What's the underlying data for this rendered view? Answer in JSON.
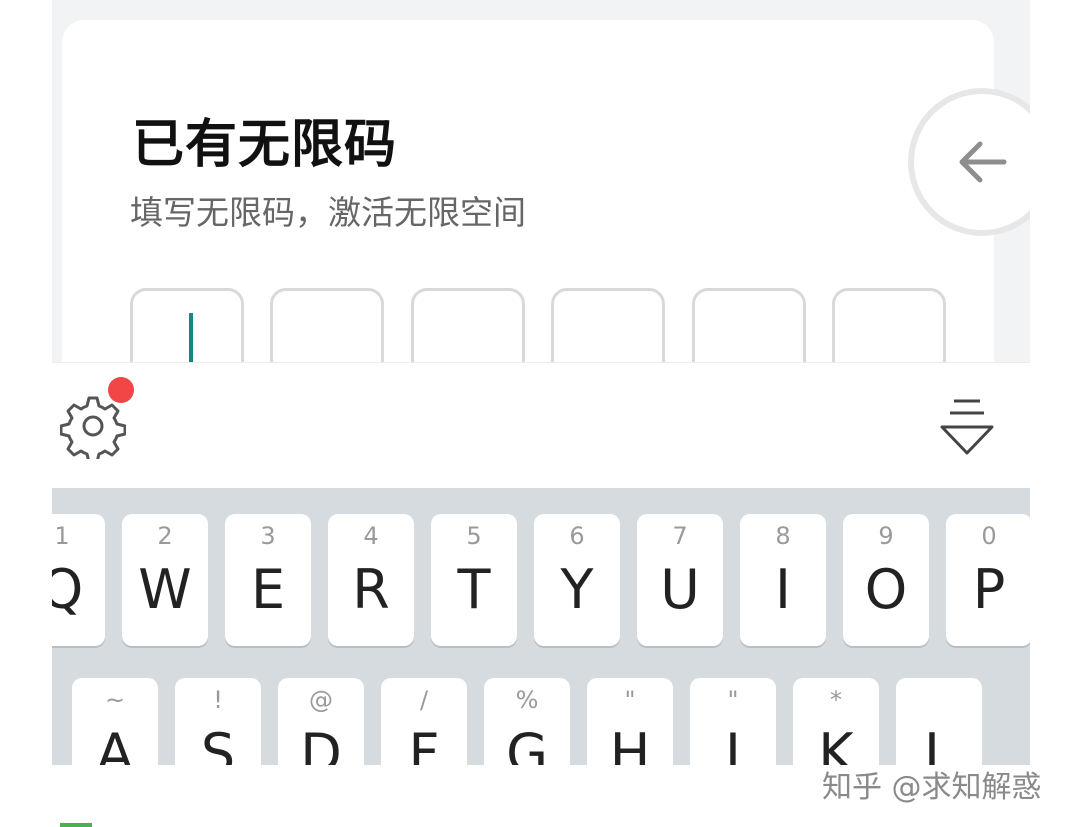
{
  "header": {
    "title": "已有无限码",
    "subtitle": "填写无限码，激活无限空间"
  },
  "code_input": {
    "box_count": 6,
    "values": [
      "",
      "",
      "",
      "",
      "",
      ""
    ]
  },
  "icons": {
    "back": "arrow-left-icon",
    "settings": "gear-icon",
    "hide_keyboard": "keyboard-hide-icon"
  },
  "keyboard": {
    "row1": [
      {
        "main": "Q",
        "alt": "1"
      },
      {
        "main": "W",
        "alt": "2"
      },
      {
        "main": "E",
        "alt": "3"
      },
      {
        "main": "R",
        "alt": "4"
      },
      {
        "main": "T",
        "alt": "5"
      },
      {
        "main": "Y",
        "alt": "6"
      },
      {
        "main": "U",
        "alt": "7"
      },
      {
        "main": "I",
        "alt": "8"
      },
      {
        "main": "O",
        "alt": "9"
      },
      {
        "main": "P",
        "alt": "0"
      }
    ],
    "row2": [
      {
        "main": "A",
        "alt": "~"
      },
      {
        "main": "S",
        "alt": "!"
      },
      {
        "main": "D",
        "alt": "@"
      },
      {
        "main": "F",
        "alt": "/"
      },
      {
        "main": "G",
        "alt": "%"
      },
      {
        "main": "H",
        "alt": "\""
      },
      {
        "main": "J",
        "alt": "\""
      },
      {
        "main": "K",
        "alt": "*"
      },
      {
        "main": "L",
        "alt": ""
      }
    ]
  },
  "watermark": "知乎 @求知解惑",
  "colors": {
    "caret": "#0d8a84",
    "badge": "#f04646",
    "keyboard_bg": "#d6dbdf"
  }
}
